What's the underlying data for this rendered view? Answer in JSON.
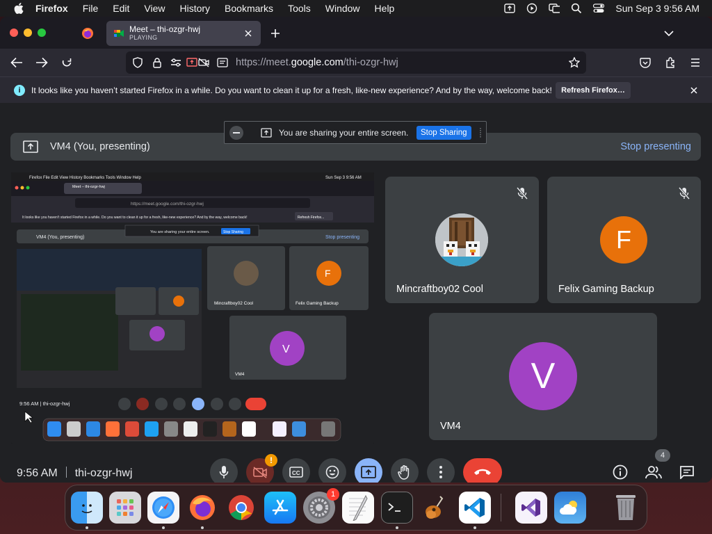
{
  "menubar": {
    "app": "Firefox",
    "items": [
      "File",
      "Edit",
      "View",
      "History",
      "Bookmarks",
      "Tools",
      "Window",
      "Help"
    ],
    "datetime": "Sun Sep 3  9:56 AM"
  },
  "browser": {
    "tab": {
      "title": "Meet – thi-ozgr-hwj",
      "subtitle": "PLAYING"
    },
    "url": {
      "prefix": "https://meet.",
      "domain": "google.com",
      "path": "/thi-ozgr-hwj"
    },
    "notification": {
      "text": "It looks like you haven’t started Firefox in a while. Do you want to clean it up for a fresh, like-new experience? And by the way, welcome back!",
      "button": "Refresh Firefox…"
    }
  },
  "meet": {
    "presenting_label": "VM4 (You, presenting)",
    "stop_presenting": "Stop presenting",
    "share_notice": "You are sharing your entire screen.",
    "stop_sharing": "Stop Sharing",
    "participants": [
      {
        "name": "Mincraftboy02 Cool",
        "initial": "",
        "color": "#5a4a3a"
      },
      {
        "name": "Felix Gaming Backup",
        "initial": "F",
        "color": "#e8710a"
      },
      {
        "name": "VM4",
        "initial": "V",
        "color": "#a142c4"
      }
    ],
    "time": "9:56 AM",
    "meeting_code": "thi-ozgr-hwj",
    "people_count": "4",
    "camera_alert": "!"
  },
  "dock": {
    "apps": [
      "Finder",
      "Launchpad",
      "Safari",
      "Firefox",
      "Chrome",
      "App Store",
      "System Settings",
      "TextEdit",
      "Terminal",
      "GarageBand",
      "Visual Studio Code",
      "Visual Studio",
      "Weather",
      "Trash"
    ],
    "settings_badge": "1"
  },
  "colors": {
    "accent": "#8ab4f8",
    "end_call": "#ea4335",
    "present_active": "#8ab4f8"
  }
}
